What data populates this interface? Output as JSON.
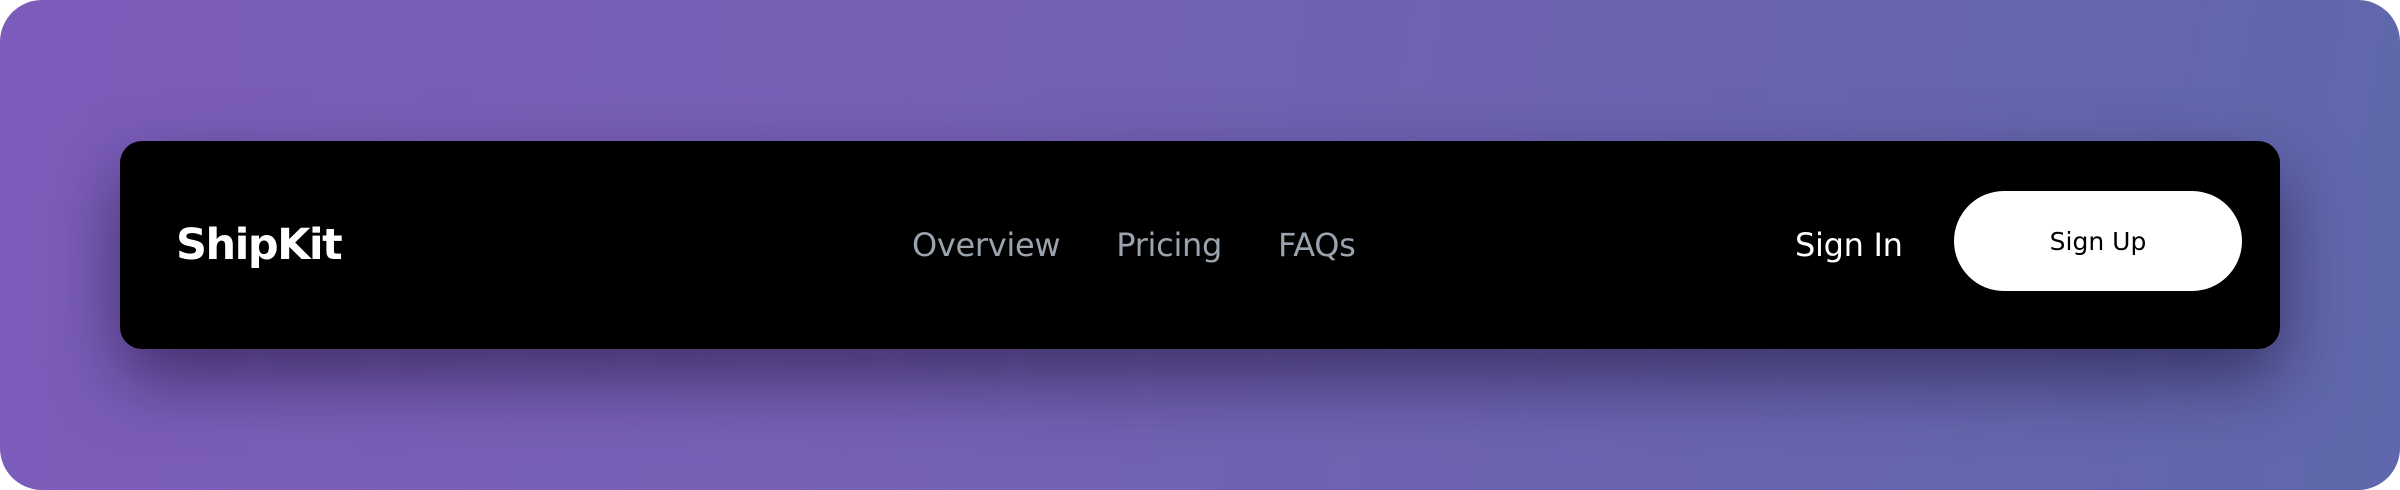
{
  "navbar": {
    "brand": "ShipKit",
    "links": [
      {
        "label": "Overview"
      },
      {
        "label": "Pricing"
      },
      {
        "label": "FAQs"
      }
    ],
    "sign_in": "Sign In",
    "sign_up": "Sign Up"
  },
  "colors": {
    "navbar_background": "#000000",
    "link_muted": "#9aa3ae",
    "text_primary": "#ffffff",
    "button_background": "#ffffff",
    "button_text": "#000000",
    "page_gradient_start": "#7c5cba",
    "page_gradient_end": "#5f68ac"
  }
}
